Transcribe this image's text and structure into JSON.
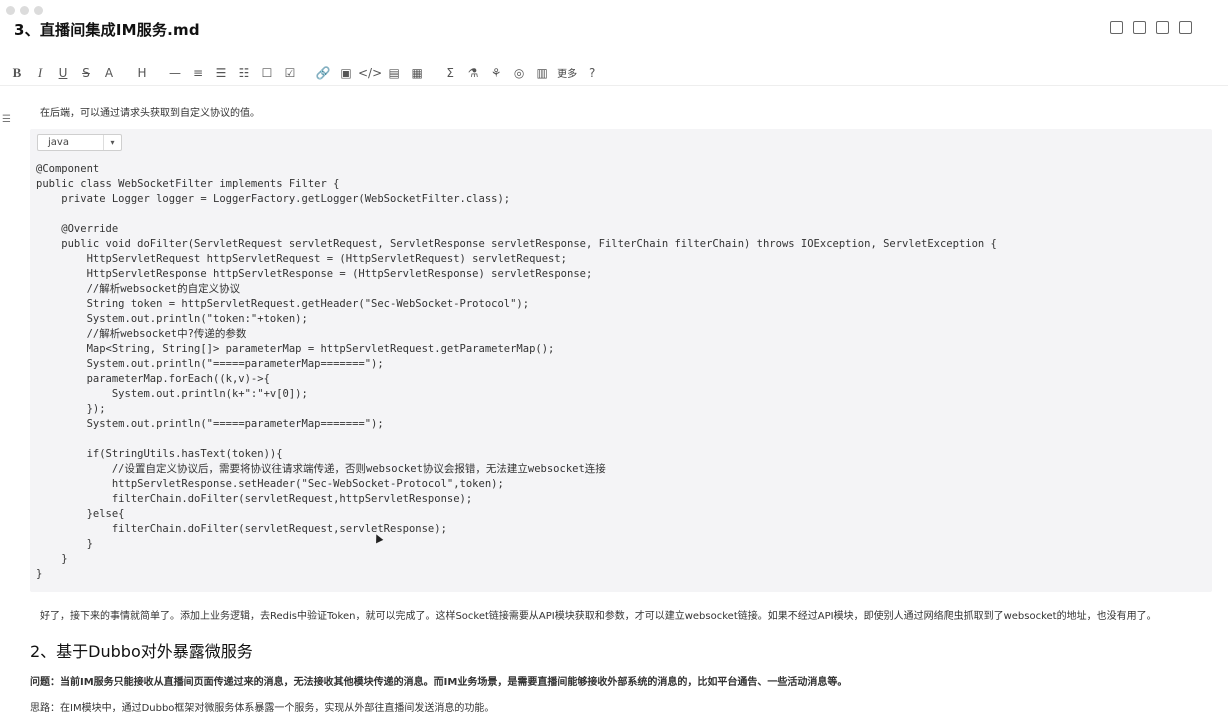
{
  "document": {
    "title": "3、直播间集成IM服务.md"
  },
  "toolbar": {
    "items": [
      "B",
      "I",
      "U",
      "S",
      "A",
      "H",
      "—",
      "≡",
      "☰",
      "☷",
      "☐",
      "☑",
      "🔗",
      "▣",
      "</>",
      "▤",
      "▦",
      "Σ",
      "⚗",
      "⚘",
      "◎",
      "▥",
      "更多",
      "?"
    ],
    "more_label": "更多"
  },
  "content": {
    "para_before": "在后端，可以通过请求头获取到自定义协议的值。",
    "code_lang": "java",
    "code_lines": [
      "@Component",
      "public class WebSocketFilter implements Filter {",
      "    private Logger logger = LoggerFactory.getLogger(WebSocketFilter.class);",
      "",
      "    @Override",
      "    public void doFilter(ServletRequest servletRequest, ServletResponse servletResponse, FilterChain filterChain) throws IOException, ServletException {",
      "        HttpServletRequest httpServletRequest = (HttpServletRequest) servletRequest;",
      "        HttpServletResponse httpServletResponse = (HttpServletResponse) servletResponse;",
      "        //解析websocket的自定义协议",
      "        String token = httpServletRequest.getHeader(\"Sec-WebSocket-Protocol\");",
      "        System.out.println(\"token:\"+token);",
      "        //解析websocket中?传递的参数",
      "        Map<String, String[]> parameterMap = httpServletRequest.getParameterMap();",
      "        System.out.println(\"=====parameterMap=======\");",
      "        parameterMap.forEach((k,v)->{",
      "            System.out.println(k+\":\"+v[0]);",
      "        });",
      "        System.out.println(\"=====parameterMap=======\");",
      "",
      "        if(StringUtils.hasText(token)){",
      "            //设置自定义协议后，需要将协议往请求端传递，否则websocket协议会报错，无法建立websocket连接",
      "            httpServletResponse.setHeader(\"Sec-WebSocket-Protocol\",token);",
      "            filterChain.doFilter(servletRequest,httpServletResponse);",
      "        }else{",
      "            filterChain.doFilter(servletRequest,servletResponse);",
      "        }",
      "    }",
      "}"
    ],
    "para_after": "好了，接下来的事情就简单了。添加上业务逻辑，去Redis中验证Token，就可以完成了。这样Socket链接需要从API模块获取和参数，才可以建立websocket链接。如果不经过API模块，即使别人通过网络爬虫抓取到了websocket的地址，也没有用了。",
    "heading": "2、基于Dubbo对外暴露微服务",
    "question": "问题：当前IM服务只能接收从直播间页面传递过来的消息，无法接收其他模块传递的消息。而IM业务场景，是需要直播间能够接收外部系统的消息的，比如平台通告、一些活动消息等。",
    "idea": "思路：在IM模块中，通过Dubbo框架对微服务体系暴露一个服务，实现从外部往直播间发送消息的功能。"
  }
}
